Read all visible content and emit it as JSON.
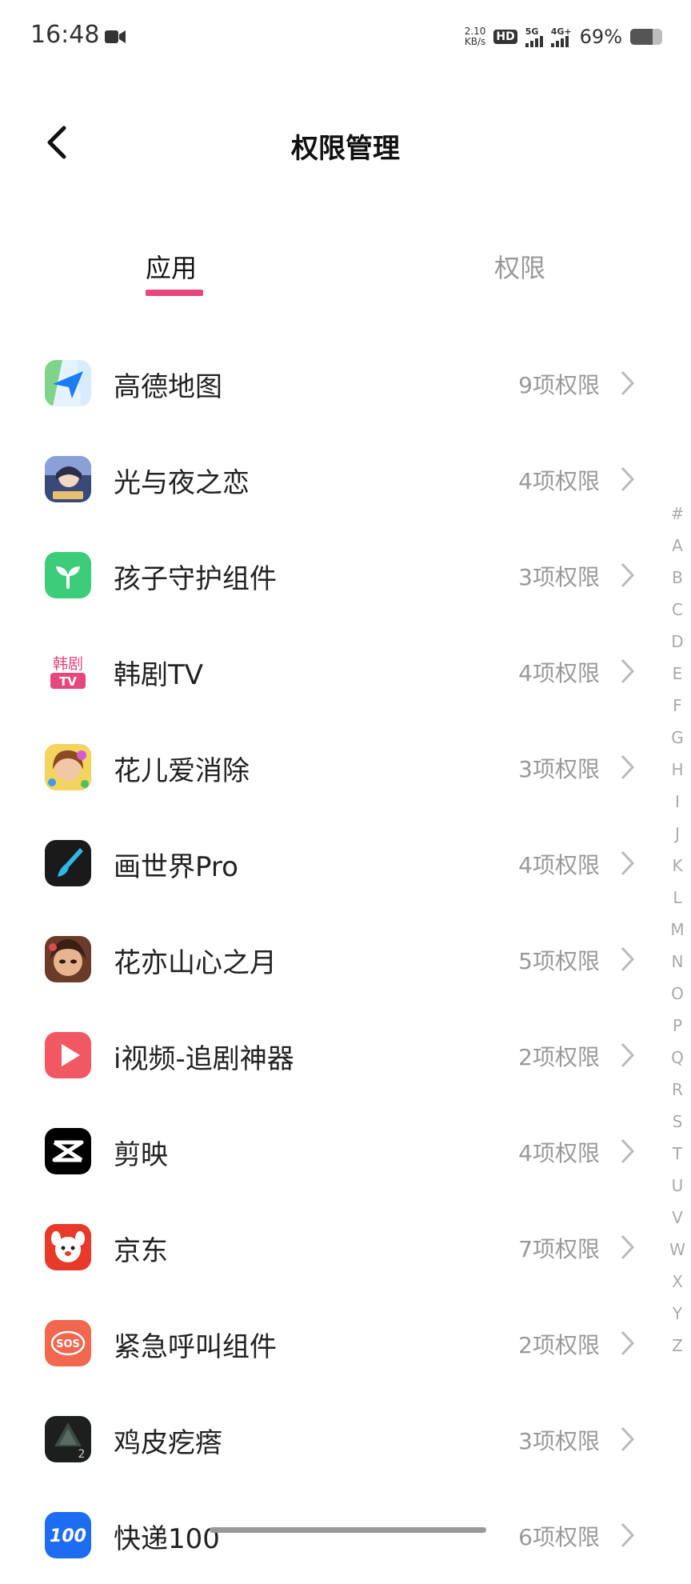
{
  "status": {
    "time": "16:48",
    "net_speed_value": "2.10",
    "net_speed_unit": "KB/s",
    "hd": "HD",
    "sim1_label": "5G",
    "sim2_label": "4G+",
    "battery_pct": "69%",
    "battery_level": 0.69
  },
  "header": {
    "title": "权限管理"
  },
  "tabs": {
    "apps": "应用",
    "permissions": "权限"
  },
  "apps": [
    {
      "name": "高德地图",
      "count": "9项权限"
    },
    {
      "name": "光与夜之恋",
      "count": "4项权限"
    },
    {
      "name": "孩子守护组件",
      "count": "3项权限"
    },
    {
      "name": "韩剧TV",
      "count": "4项权限"
    },
    {
      "name": "花儿爱消除",
      "count": "3项权限"
    },
    {
      "name": "画世界Pro",
      "count": "4项权限"
    },
    {
      "name": "花亦山心之月",
      "count": "5项权限"
    },
    {
      "name": "i视频-追剧神器",
      "count": "2项权限"
    },
    {
      "name": "剪映",
      "count": "4项权限"
    },
    {
      "name": "京东",
      "count": "7项权限"
    },
    {
      "name": "紧急呼叫组件",
      "count": "2项权限"
    },
    {
      "name": "鸡皮疙瘩",
      "count": "3项权限"
    },
    {
      "name": "快递100",
      "count": "6项权限"
    }
  ],
  "icon_labels": {
    "hanju_top": "韩剧",
    "hanju_bottom": "TV",
    "sos": "SOS",
    "kuaidi": "100",
    "jipi": "2"
  },
  "index_letters": [
    "#",
    "A",
    "B",
    "C",
    "D",
    "E",
    "F",
    "G",
    "H",
    "I",
    "J",
    "K",
    "L",
    "M",
    "N",
    "O",
    "P",
    "Q",
    "R",
    "S",
    "T",
    "U",
    "V",
    "W",
    "X",
    "Y",
    "Z"
  ],
  "colors": {
    "accent": "#e5487d",
    "secondary_text": "#999999"
  }
}
